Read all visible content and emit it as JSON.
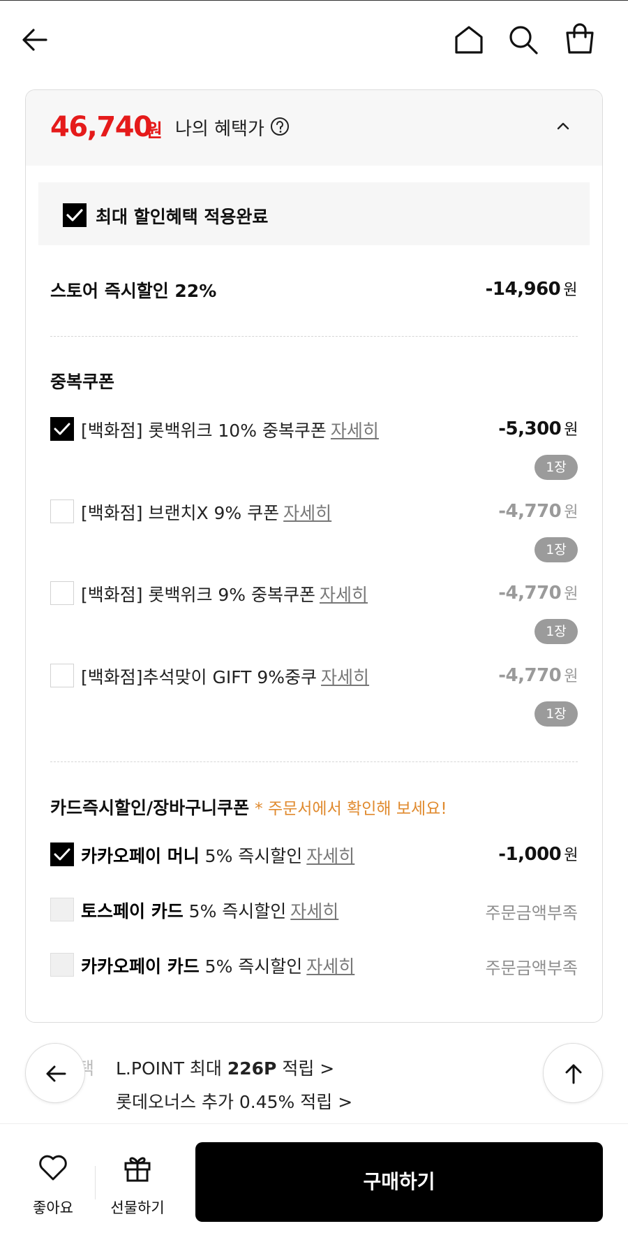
{
  "header": {
    "icons": [
      "back-icon",
      "home-icon",
      "search-icon",
      "shopping-bag-icon"
    ]
  },
  "benefit": {
    "price": "46,740",
    "price_unit": "원",
    "label": "나의 혜택가",
    "applied_text": "최대 할인혜택 적용완료",
    "accent_color": "#e51b1b"
  },
  "store_discount": {
    "label": "스토어 즉시할인 22%",
    "amount": "-14,960",
    "unit": "원"
  },
  "duplicate_coupons": {
    "title": "중복쿠폰",
    "detail_label": "자세히",
    "items": [
      {
        "name": "[백화점] 롯백위크 10% 중복쿠폰",
        "amount": "-5,300",
        "unit": "원",
        "count": "1장",
        "checked": true
      },
      {
        "name": "[백화점] 브랜치X 9% 쿠폰",
        "amount": "-4,770",
        "unit": "원",
        "count": "1장",
        "checked": false
      },
      {
        "name": "[백화점] 롯백위크 9% 중복쿠폰",
        "amount": "-4,770",
        "unit": "원",
        "count": "1장",
        "checked": false
      },
      {
        "name": "[백화점]추석맞이 GIFT 9%중쿠",
        "amount": "-4,770",
        "unit": "원",
        "count": "1장",
        "checked": false
      }
    ]
  },
  "card_discounts": {
    "title": "카드즉시할인/장바구니쿠폰",
    "note": "* 주문서에서 확인해 보세요!",
    "detail_label": "자세히",
    "items": [
      {
        "name_bold": "카카오페이 머니",
        "name_rest": " 5% 즉시할인",
        "amount": "-1,000",
        "unit": "원",
        "checked": true
      },
      {
        "name_bold": "토스페이 카드",
        "name_rest": " 5% 즉시할인",
        "status": "주문금액부족",
        "checked": false
      },
      {
        "name_bold": "카카오페이 카드",
        "name_rest": " 5% 즉시할인",
        "status": "주문금액부족",
        "checked": false
      }
    ]
  },
  "points": {
    "partial_label": "택",
    "lpoint_prefix": "L.POINT 최대 ",
    "lpoint_amount": "226P",
    "lpoint_suffix": " 적립 >",
    "lotte_plus": "롯데오너스 추가 0.45% 적립 >"
  },
  "bottom_bar": {
    "like_label": "좋아요",
    "gift_label": "선물하기",
    "buy_label": "구매하기"
  }
}
